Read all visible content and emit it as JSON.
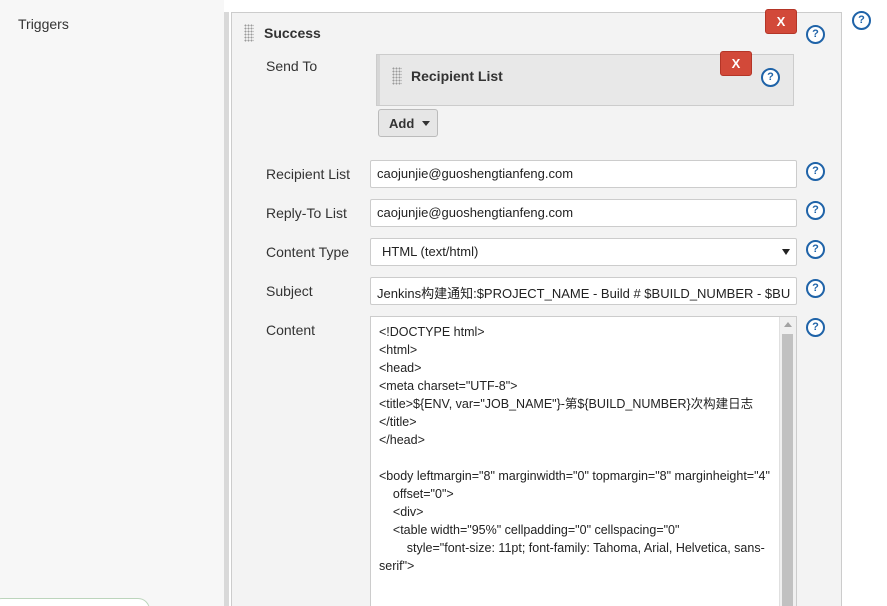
{
  "sidebar": {
    "triggers_label": "Triggers"
  },
  "success_section": {
    "title": "Success",
    "delete_label": "X",
    "help_label": "?"
  },
  "page_help_label": "?",
  "send_to": {
    "label": "Send To",
    "recipient_list_title": "Recipient List",
    "delete_label": "X",
    "help_label": "?",
    "add_button_label": "Add"
  },
  "fields": {
    "recipient_list": {
      "label": "Recipient List",
      "value": "caojunjie@guoshengtianfeng.com",
      "help_label": "?"
    },
    "reply_to_list": {
      "label": "Reply-To List",
      "value": "caojunjie@guoshengtianfeng.com",
      "help_label": "?"
    },
    "content_type": {
      "label": "Content Type",
      "selected": "HTML (text/html)",
      "help_label": "?"
    },
    "subject": {
      "label": "Subject",
      "value": "Jenkins构建通知:$PROJECT_NAME - Build # $BUILD_NUMBER - $BU",
      "help_label": "?"
    },
    "content": {
      "label": "Content",
      "help_label": "?",
      "text": "<!DOCTYPE html>\n<html>\n<head>\n<meta charset=\"UTF-8\">\n<title>${ENV, var=\"JOB_NAME\"}-第${BUILD_NUMBER}次构建日志\n</title>\n</head>\n\n<body leftmargin=\"8\" marginwidth=\"0\" topmargin=\"8\" marginheight=\"4\"\n    offset=\"0\">\n    <div>\n    <table width=\"95%\" cellpadding=\"0\" cellspacing=\"0\"\n        style=\"font-size: 11pt; font-family: Tahoma, Arial, Helvetica, sans-serif\">"
    }
  },
  "colors": {
    "delete_button": "#d24939",
    "help_icon": "#1f63a8",
    "panel_background": "#f3f3f3"
  }
}
